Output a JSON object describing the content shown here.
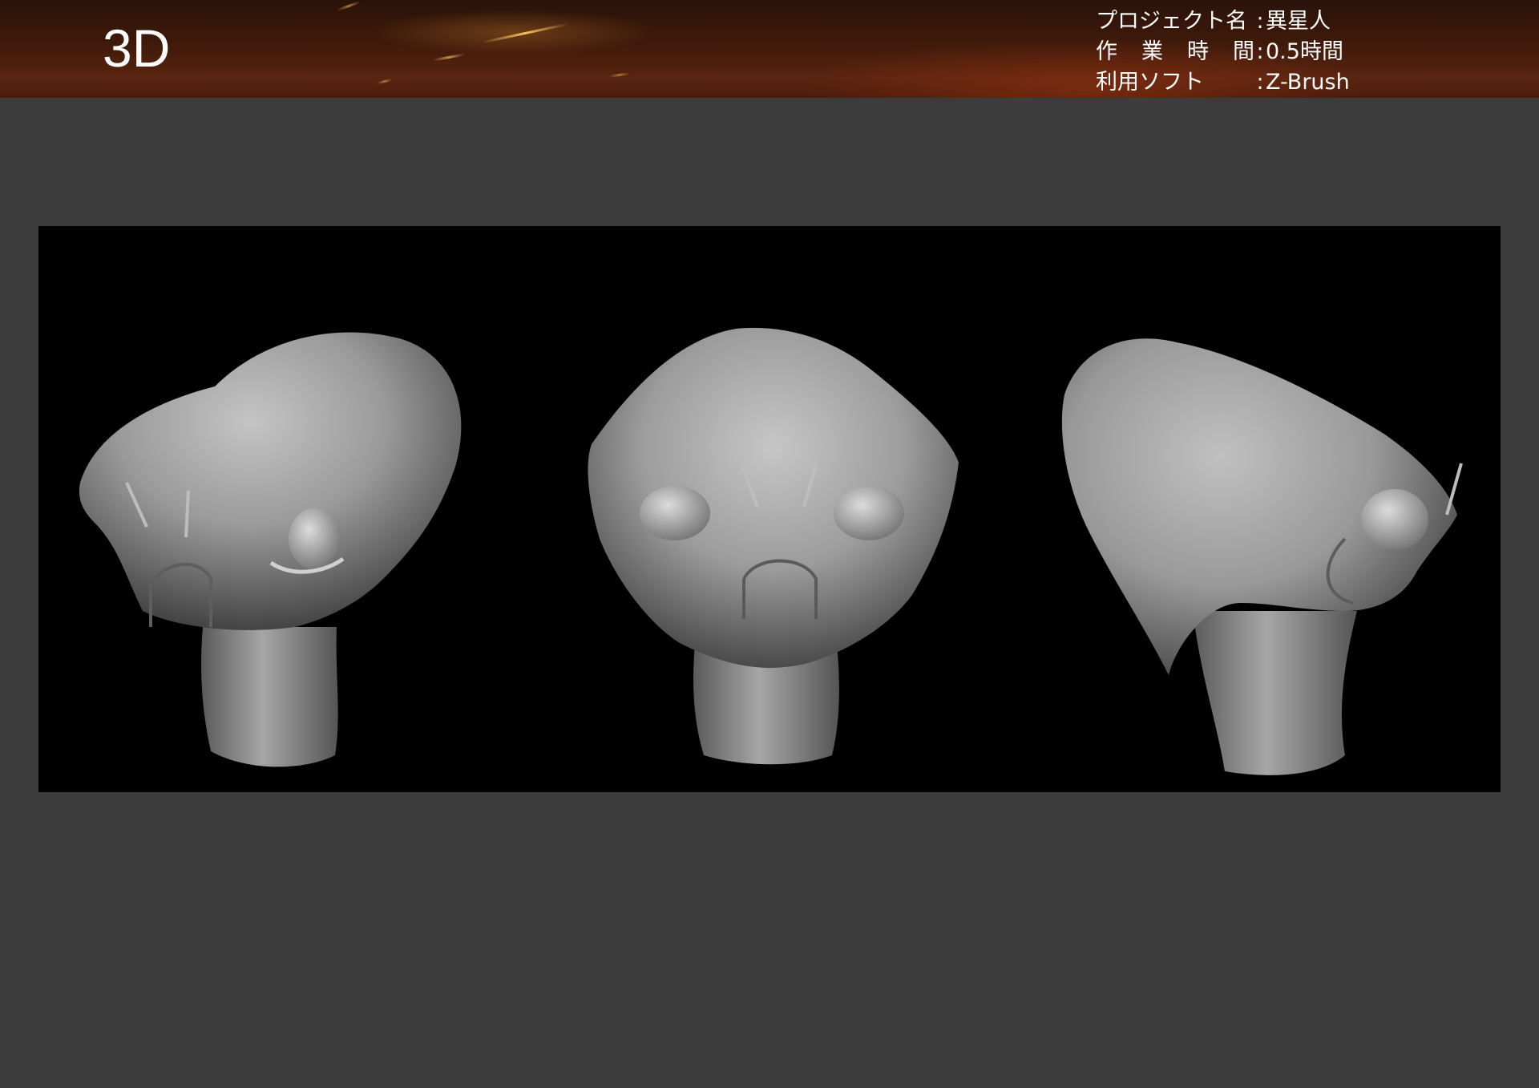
{
  "header": {
    "title": "3D",
    "info": [
      {
        "label": "プロジェクト名",
        "sep": ":",
        "value": "異星人"
      },
      {
        "label": "作 業 時 間",
        "sep": ":",
        "value": "0.5時間"
      },
      {
        "label": "利用ソフト",
        "sep": ":",
        "value": "Z-Brush"
      }
    ]
  },
  "viewport": {
    "background": "#000000",
    "views": [
      {
        "name": "three-quarter-view",
        "icon": "alien-head-three-quarter"
      },
      {
        "name": "front-view",
        "icon": "alien-head-front"
      },
      {
        "name": "side-view",
        "icon": "alien-head-side"
      }
    ]
  },
  "colors": {
    "page_background": "#3c3c3c",
    "header_background": "#4a1c0c",
    "sculpt_clay": "#9a9a9a"
  }
}
